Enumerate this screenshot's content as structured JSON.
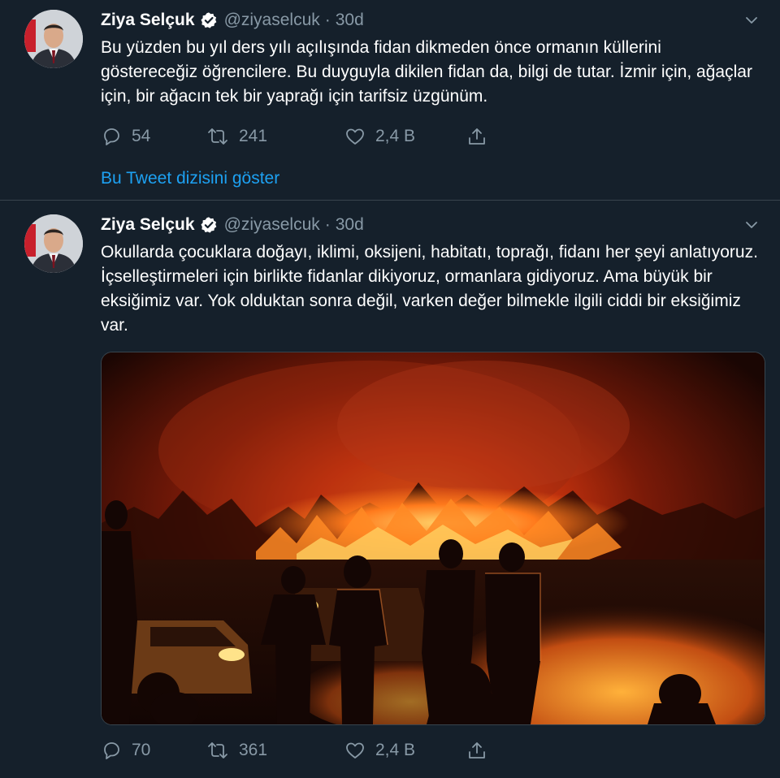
{
  "tweets": [
    {
      "author_name": "Ziya Selçuk",
      "handle": "@ziyaselcuk",
      "separator": "·",
      "time": "30d",
      "text": "Bu yüzden bu yıl ders yılı açılışında fidan dikmeden önce ormanın küllerini göstereceğiz öğrencilere. Bu duyguyla dikilen fidan da, bilgi de tutar. İzmir için, ağaçlar için, bir ağacın tek bir yaprağı için tarifsiz üzgünüm.",
      "replies": "54",
      "retweets": "241",
      "likes": "2,4 B",
      "thread_link": "Bu Tweet dizisini göster"
    },
    {
      "author_name": "Ziya Selçuk",
      "handle": "@ziyaselcuk",
      "separator": "·",
      "time": "30d",
      "text": "Okullarda çocuklara doğayı, iklimi, oksijeni, habitatı, toprağı, fidanı her şeyi anlatıyoruz. İçselleştirmeleri için birlikte fidanlar dikiyoruz, ormanlara gidiyoruz. Ama büyük bir eksiğimiz var. Yok olduktan sonra değil, varken değer bilmekle ilgili ciddi bir eksiğimiz var.",
      "replies": "70",
      "retweets": "361",
      "likes": "2,4 B",
      "media": "forest-fire-photo"
    }
  ],
  "icons": {
    "verified": "verified-badge-icon",
    "caret": "chevron-down-icon",
    "reply": "reply-icon",
    "retweet": "retweet-icon",
    "like": "heart-icon",
    "share": "share-icon"
  },
  "colors": {
    "background": "#15202b",
    "muted": "#8899a6",
    "link": "#1da1f2",
    "divider": "#38444d"
  }
}
